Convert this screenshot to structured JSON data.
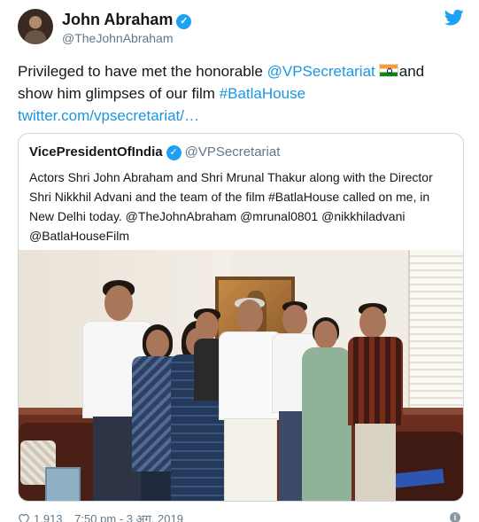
{
  "tweet": {
    "author": {
      "name": "John Abraham",
      "handle": "@TheJohnAbraham",
      "verified": true
    },
    "text": {
      "part1": "Privileged to have met the honorable ",
      "mention": "@VPSecretariat",
      "flag_icon": "india-flag-icon",
      "part2": "and show him glimpses of our film ",
      "hashtag": "#BatlaHouse",
      "url": "twitter.com/vpsecretariat/…"
    },
    "quoted": {
      "name": "VicePresidentOfIndia",
      "handle": "@VPSecretariat",
      "verified": true,
      "text": "Actors Shri John Abraham and Shri Mrunal Thakur along with the Director Shri Nikkhil Advani and the team of the film #BatlaHouse called on me, in New Delhi today. @TheJohnAbraham @mrunal0801 @nikkhiladvani @BatlaHouseFilm"
    },
    "meta": {
      "likes": "1,913",
      "time": "7:50 pm - 3 अग. 2019"
    }
  },
  "colors": {
    "link": "#1b95e0",
    "verified": "#1da1f2",
    "muted": "#657786",
    "border": "#ccd6dd"
  },
  "icons": [
    "avatar",
    "verified-badge-icon",
    "twitter-bird-icon",
    "india-flag-icon",
    "heart-icon",
    "info-icon"
  ]
}
